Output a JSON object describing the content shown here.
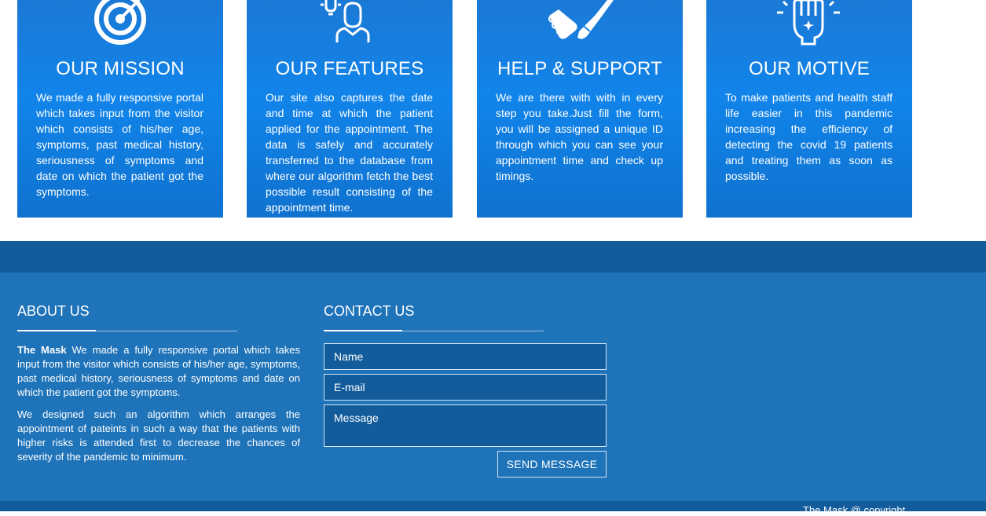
{
  "cards": [
    {
      "icon": "target-icon",
      "title": "OUR MISSION",
      "text": "We made a fully responsive portal which takes input from the visitor which consists of his/her age, symptoms, past medical history, seriousness of symptoms and date on which the patient got the symptoms."
    },
    {
      "icon": "doctor-idea-icon",
      "title": "OUR FEATURES",
      "text": "Our site also captures the date and time at which the patient applied for the appointment. The data is safely and accurately transferred to the database from where our algorithm fetch the best possible result consisting of the appointment time."
    },
    {
      "icon": "handshake-icon",
      "title": "HELP & SUPPORT",
      "text": "We are there with with in every step you take.Just fill the form, you will be assigned a unique ID through which you can see your appointment time and check up timings."
    },
    {
      "icon": "raised-hand-icon",
      "title": "OUR MOTIVE",
      "text": "To make patients and health staff life easier in this pandemic increasing the efficiency of detecting the covid 19 patients and treating them as soon as possible."
    }
  ],
  "footer": {
    "about": {
      "title": "ABOUT US",
      "brand": "The Mask",
      "paragraph1": " We made a fully responsive portal which takes input from the visitor which consists of his/her age, symptoms, past medical history, seriousness of symptoms and date on which the patient got the symptoms.",
      "paragraph2": "We designed such an algorithm which arranges the appointment of pateints in such a way that the patients with higher risks is attended first to decrease the chances of severity of the pandemic to minimum."
    },
    "contact": {
      "title": "CONTACT US",
      "name_placeholder": "Name",
      "email_placeholder": "E-mail",
      "message_placeholder": "Message",
      "send_label": "SEND MESSAGE"
    },
    "copyright": "The Mask @ copyright"
  },
  "colors": {
    "card_blue": "#1184ea",
    "footer_dark": "#135c9b",
    "footer_main": "#1f73b9"
  }
}
